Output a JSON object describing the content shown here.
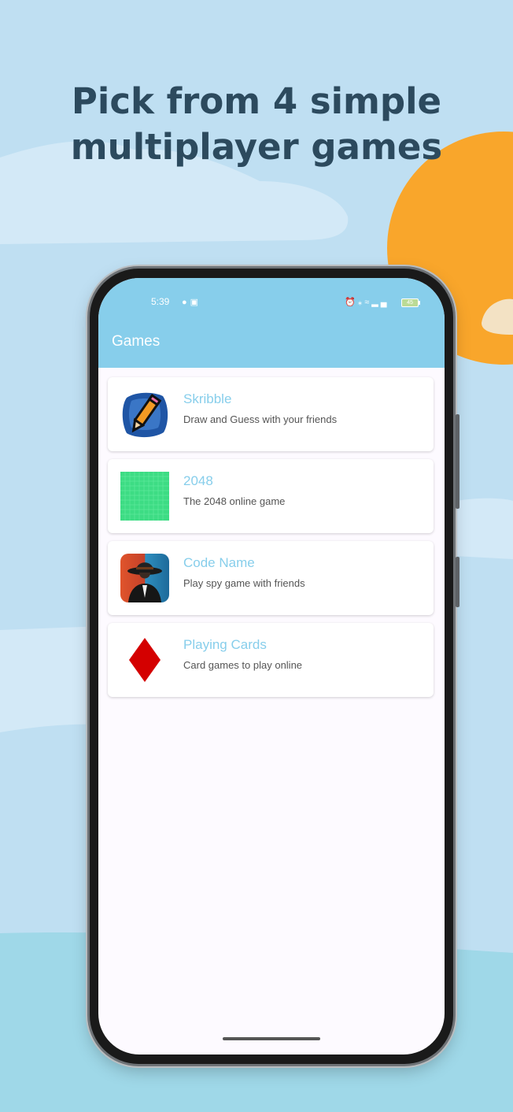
{
  "promo": {
    "headline_line1": "Pick from 4 simple",
    "headline_line2": "multiplayer games"
  },
  "status_bar": {
    "time": "5:39",
    "left_icons": [
      "snapchat-icon",
      "instagram-icon"
    ],
    "right_icons": [
      "alarm-icon",
      "bluetooth-icon",
      "wifi-icon",
      "signal-icon"
    ],
    "battery": "45"
  },
  "app_bar": {
    "title": "Games"
  },
  "games": [
    {
      "title": "Skribble",
      "subtitle": "Draw and Guess with your friends",
      "icon": "pencil-icon"
    },
    {
      "title": "2048",
      "subtitle": "The 2048 online game",
      "icon": "grid-icon"
    },
    {
      "title": "Code Name",
      "subtitle": "Play spy game with friends",
      "icon": "spy-icon"
    },
    {
      "title": "Playing Cards",
      "subtitle": "Card games to play online",
      "icon": "diamond-icon"
    }
  ],
  "colors": {
    "background": "#bfdff2",
    "headline": "#2c4a5e",
    "sun": "#f9a62b",
    "app_bar": "#87ceeb",
    "card_title": "#87ceeb",
    "grid_green": "#3ddc84",
    "diamond_red": "#d40000"
  }
}
